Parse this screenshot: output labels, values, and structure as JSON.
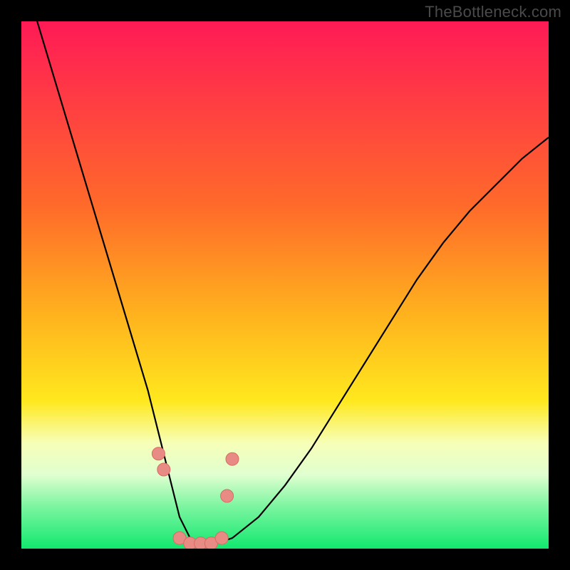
{
  "watermark": "TheBottleneck.com",
  "colors": {
    "border": "#000000",
    "curve": "#000000",
    "marker_fill": "#e88b84",
    "marker_stroke": "#d86b62",
    "grad_top": "#ff1a56",
    "grad_mid1": "#ff8a1e",
    "grad_mid2": "#ffe81e",
    "grad_band": "#f7ffb8",
    "grad_bottom": "#11e86f"
  },
  "chart_data": {
    "type": "line",
    "title": "",
    "xlabel": "",
    "ylabel": "",
    "xlim": [
      0,
      100
    ],
    "ylim": [
      0,
      100
    ],
    "series": [
      {
        "name": "bottleneck-curve",
        "x": [
          0,
          3,
          6,
          9,
          12,
          15,
          18,
          21,
          24,
          26,
          28,
          30,
          32,
          34,
          37,
          40,
          45,
          50,
          55,
          60,
          65,
          70,
          75,
          80,
          85,
          90,
          95,
          100
        ],
        "y": [
          110,
          100,
          90,
          80,
          70,
          60,
          50,
          40,
          30,
          22,
          14,
          6,
          2,
          1,
          1,
          2,
          6,
          12,
          19,
          27,
          35,
          43,
          51,
          58,
          64,
          69,
          74,
          78
        ]
      }
    ],
    "markers": {
      "name": "highlight-points",
      "x": [
        26,
        27,
        30,
        32,
        34,
        36,
        38,
        39,
        40
      ],
      "y": [
        18,
        15,
        2,
        1,
        1,
        1,
        2,
        10,
        17
      ]
    },
    "gradient_bands": [
      {
        "pos": 0.0,
        "color": "#ff1a56"
      },
      {
        "pos": 0.35,
        "color": "#ff6a2a"
      },
      {
        "pos": 0.55,
        "color": "#ffb01e"
      },
      {
        "pos": 0.72,
        "color": "#ffe81e"
      },
      {
        "pos": 0.8,
        "color": "#f7ffb8"
      },
      {
        "pos": 0.86,
        "color": "#e0ffd0"
      },
      {
        "pos": 0.92,
        "color": "#7cf5a0"
      },
      {
        "pos": 1.0,
        "color": "#11e86f"
      }
    ]
  }
}
